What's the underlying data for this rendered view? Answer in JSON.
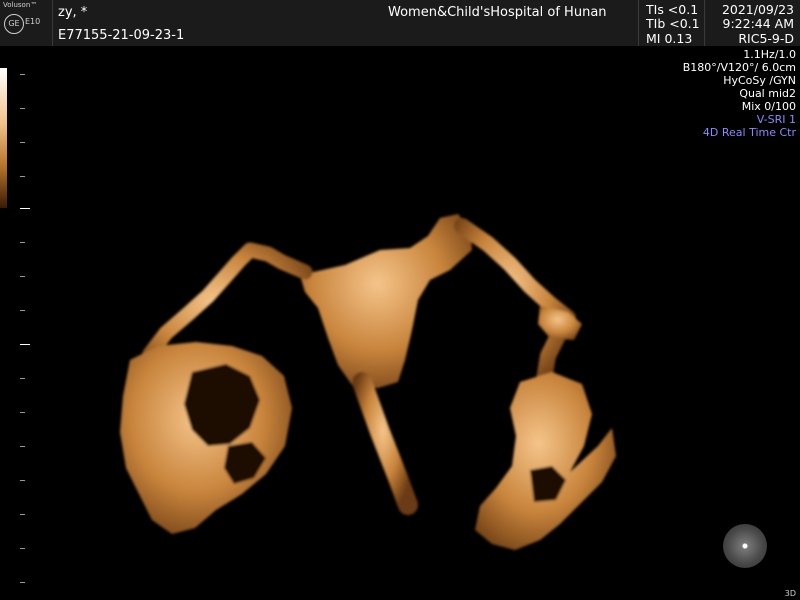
{
  "header": {
    "brand": "Voluson™",
    "logo": "GE",
    "model": "E10",
    "patient": "zy,   *",
    "exam_id": "E77155-21-09-23-1",
    "hospital": "Women&Child'sHospital of Hunan",
    "metrics": [
      "TIs <0.1",
      "TIb <0.1",
      "MI 0.13"
    ],
    "date": "2021/09/23",
    "time": "9:22:44 AM",
    "probe": "RIC5-9-D"
  },
  "parameters": [
    "1.1Hz/1.0",
    "B180°/V120°/ 6.0cm",
    "HyCoSy /GYN",
    "Qual mid2",
    "Mix 0/100"
  ],
  "highlight_parameters": [
    "V-SRI 1",
    "4D Real Time Ctr"
  ],
  "mode_label": "3D",
  "icons": {
    "logo": "ge-logo-icon",
    "orientation": "orientation-ball-icon"
  },
  "colors": {
    "header_bg": "#1b1b1b",
    "render_tone": "#c8843c",
    "highlight_text": "#8a8aff"
  }
}
